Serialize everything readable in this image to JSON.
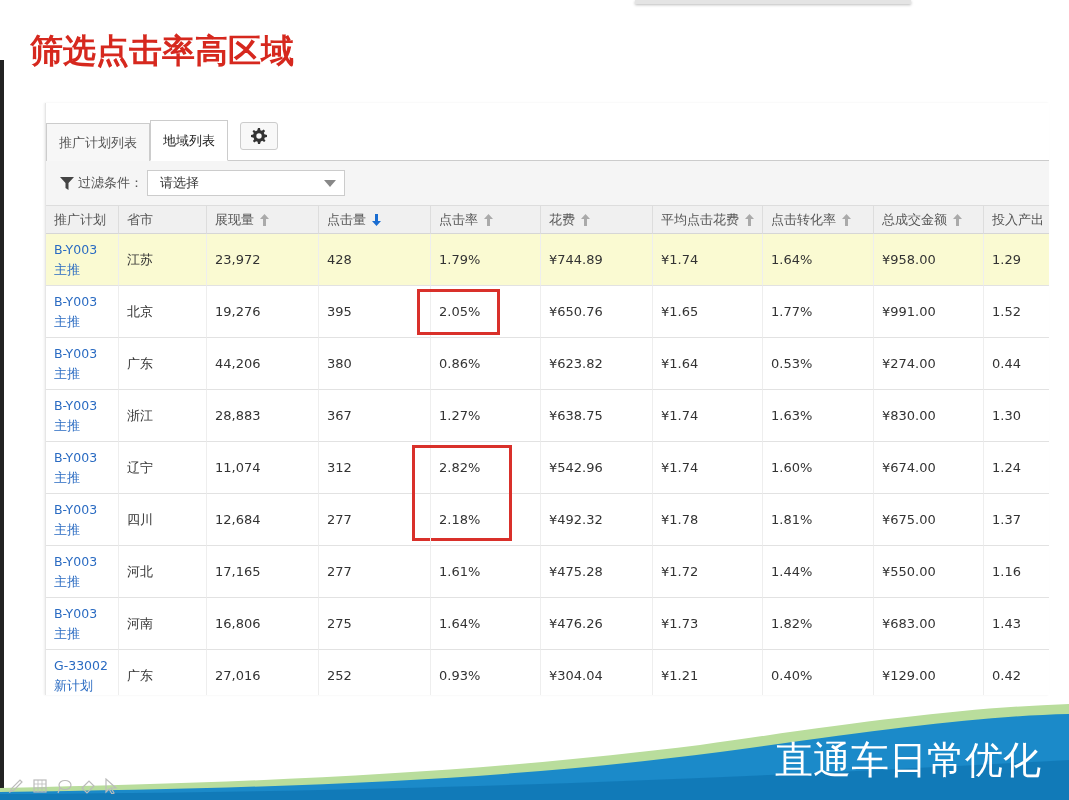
{
  "slide_title": "筛选点击率高区域",
  "tabs": [
    {
      "label": "推广计划列表",
      "selected": false
    },
    {
      "label": "地域列表",
      "selected": true
    }
  ],
  "filter": {
    "label": "过滤条件：",
    "value": "请选择"
  },
  "table": {
    "columns": [
      {
        "label": "推广计划"
      },
      {
        "label": "省市"
      },
      {
        "label": "展现量",
        "sort_active": false
      },
      {
        "label": "点击量",
        "sort_active": true
      },
      {
        "label": "点击率",
        "sort_active": false
      },
      {
        "label": "花费",
        "sort_active": false
      },
      {
        "label": "平均点击花费",
        "sort_active": false
      },
      {
        "label": "点击转化率",
        "sort_active": false
      },
      {
        "label": "总成交金额",
        "sort_active": false
      },
      {
        "label": "投入产出"
      }
    ],
    "rows": [
      {
        "cells": [
          "B-Y003 主推",
          "江苏",
          "23,972",
          "428",
          "1.79%",
          "¥744.89",
          "¥1.74",
          "1.64%",
          "¥958.00",
          "1.29"
        ],
        "highlighted": true,
        "ctr_boxed": false
      },
      {
        "cells": [
          "B-Y003 主推",
          "北京",
          "19,276",
          "395",
          "2.05%",
          "¥650.76",
          "¥1.65",
          "1.77%",
          "¥991.00",
          "1.52"
        ],
        "highlighted": false,
        "ctr_boxed": true
      },
      {
        "cells": [
          "B-Y003 主推",
          "广东",
          "44,206",
          "380",
          "0.86%",
          "¥623.82",
          "¥1.64",
          "0.53%",
          "¥274.00",
          "0.44"
        ],
        "highlighted": false,
        "ctr_boxed": false
      },
      {
        "cells": [
          "B-Y003 主推",
          "浙江",
          "28,883",
          "367",
          "1.27%",
          "¥638.75",
          "¥1.74",
          "1.63%",
          "¥830.00",
          "1.30"
        ],
        "highlighted": false,
        "ctr_boxed": false
      },
      {
        "cells": [
          "B-Y003 主推",
          "辽宁",
          "11,074",
          "312",
          "2.82%",
          "¥542.96",
          "¥1.74",
          "1.60%",
          "¥674.00",
          "1.24"
        ],
        "highlighted": false,
        "ctr_boxed": true
      },
      {
        "cells": [
          "B-Y003 主推",
          "四川",
          "12,684",
          "277",
          "2.18%",
          "¥492.32",
          "¥1.78",
          "1.81%",
          "¥675.00",
          "1.37"
        ],
        "highlighted": false,
        "ctr_boxed": true
      },
      {
        "cells": [
          "B-Y003 主推",
          "河北",
          "17,165",
          "277",
          "1.61%",
          "¥475.28",
          "¥1.72",
          "1.44%",
          "¥550.00",
          "1.16"
        ],
        "highlighted": false,
        "ctr_boxed": false
      },
      {
        "cells": [
          "B-Y003 主推",
          "河南",
          "16,806",
          "275",
          "1.64%",
          "¥476.26",
          "¥1.73",
          "1.82%",
          "¥683.00",
          "1.43"
        ],
        "highlighted": false,
        "ctr_boxed": false
      },
      {
        "cells": [
          "G-33002 新计划",
          "广东",
          "27,016",
          "252",
          "0.93%",
          "¥304.04",
          "¥1.21",
          "0.40%",
          "¥129.00",
          "0.42"
        ],
        "highlighted": false,
        "ctr_boxed": false
      }
    ]
  },
  "banner": {
    "text": "直通车日常优化"
  }
}
